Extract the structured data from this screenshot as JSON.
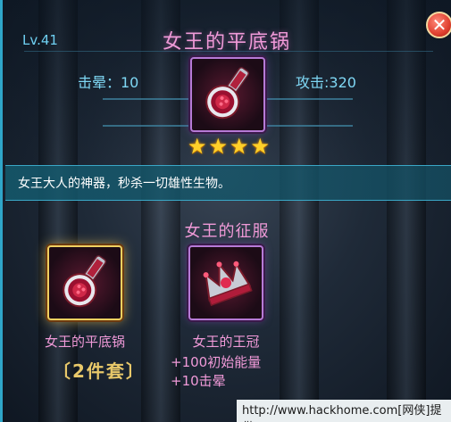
{
  "item": {
    "level": "Lv.41",
    "name": "女王的平底锅",
    "stat_left": "击晕：10",
    "stat_right": "攻击:320",
    "stars": [
      "★",
      "★",
      "★",
      "★"
    ],
    "rarity_stars_count": 4,
    "description": "女王大人的神器，秒杀一切雄性生物。"
  },
  "set": {
    "title": "女王的征服",
    "items": [
      {
        "label": "女王的平底锅"
      },
      {
        "label": "女王的王冠"
      }
    ],
    "count_label": "〔2件套〕",
    "bonuses": [
      "+100初始能量",
      "+10击晕"
    ]
  },
  "close_button": {
    "symbol": "✕"
  },
  "watermark": "http://www.hackhome.com[网侠]提供",
  "colors": {
    "accent_pink": "#f09ad8",
    "accent_cyan": "#6fd0f2",
    "star_gold": "#ffd12a",
    "close_red": "#e04030"
  }
}
